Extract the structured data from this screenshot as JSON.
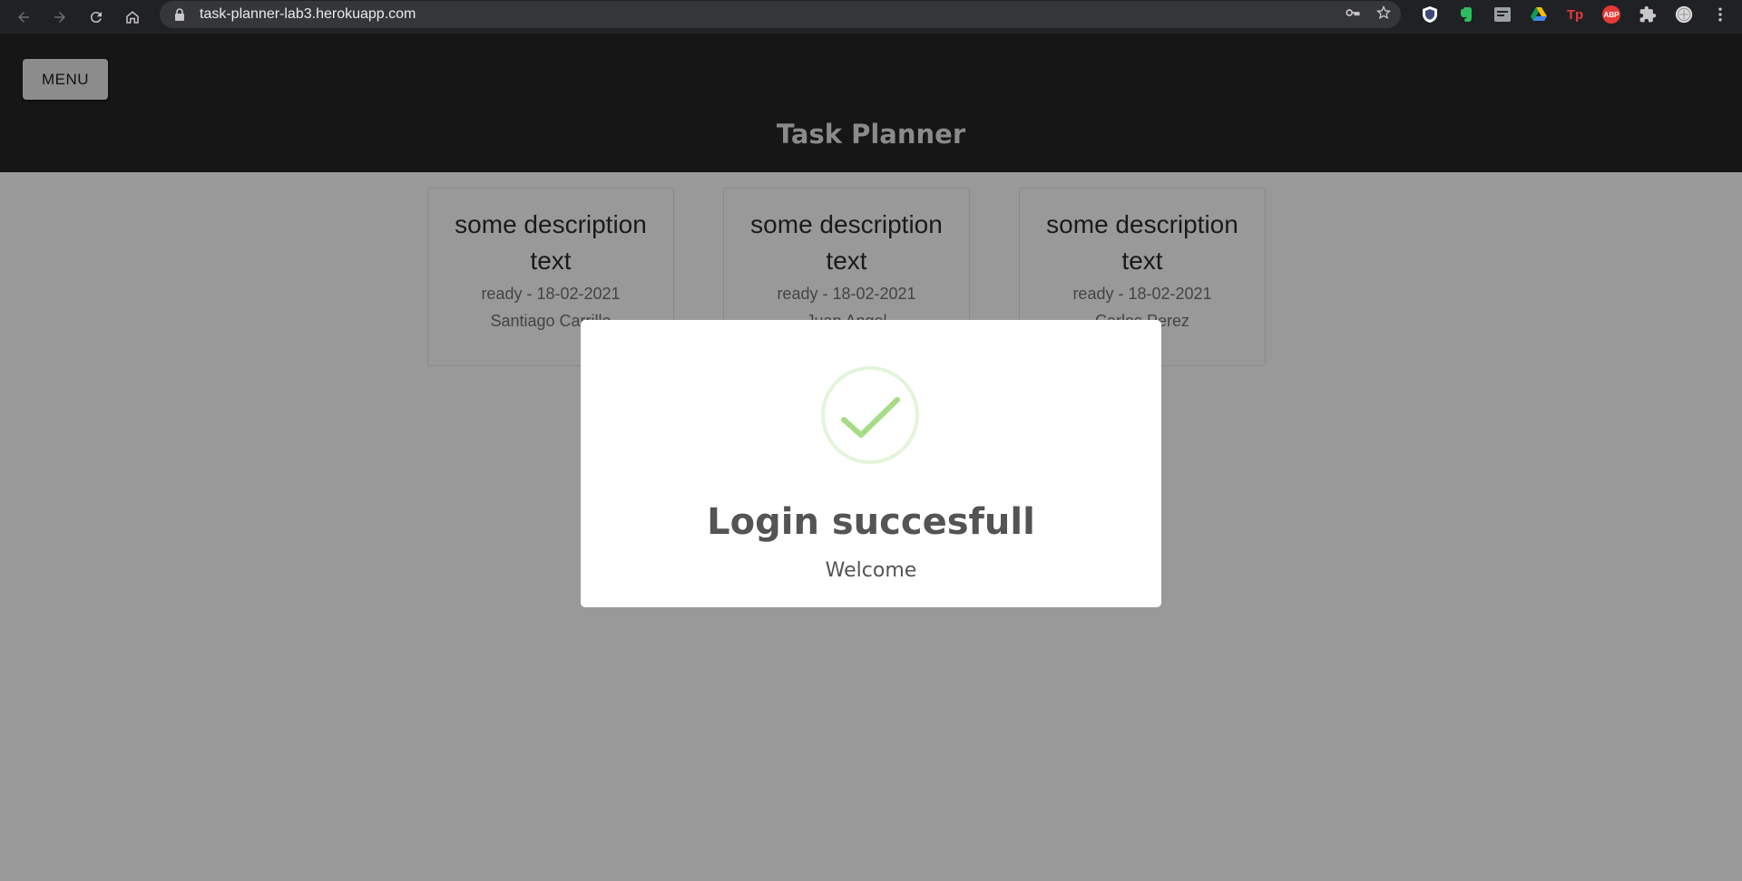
{
  "browser": {
    "url": "task-planner-lab3.herokuapp.com",
    "extensions": [
      {
        "name": "shield-extension",
        "color": "#3c4a7a"
      },
      {
        "name": "evernote-extension",
        "color": "#2dbe60"
      },
      {
        "name": "reader-extension",
        "color": "#9aa0a6"
      },
      {
        "name": "google-drive-extension",
        "color": "#fbbc04"
      },
      {
        "name": "tp-extension",
        "label": "Tp",
        "color": "#e53935"
      },
      {
        "name": "adblock-plus-extension",
        "label": "ABP",
        "color": "#e53935"
      }
    ]
  },
  "header": {
    "menu_label": "MENU",
    "title": "Task Planner"
  },
  "tasks": [
    {
      "description": "some description text",
      "status": "ready - 18-02-2021",
      "owner": "Santiago Carrillo"
    },
    {
      "description": "some description text",
      "status": "ready - 18-02-2021",
      "owner": "Juan Angel"
    },
    {
      "description": "some description text",
      "status": "ready - 18-02-2021",
      "owner": "Carlos Perez"
    }
  ],
  "modal": {
    "title": "Login succesfull",
    "text": "Welcome",
    "icon": "success-check-icon",
    "accent_color": "#a5dc86"
  }
}
